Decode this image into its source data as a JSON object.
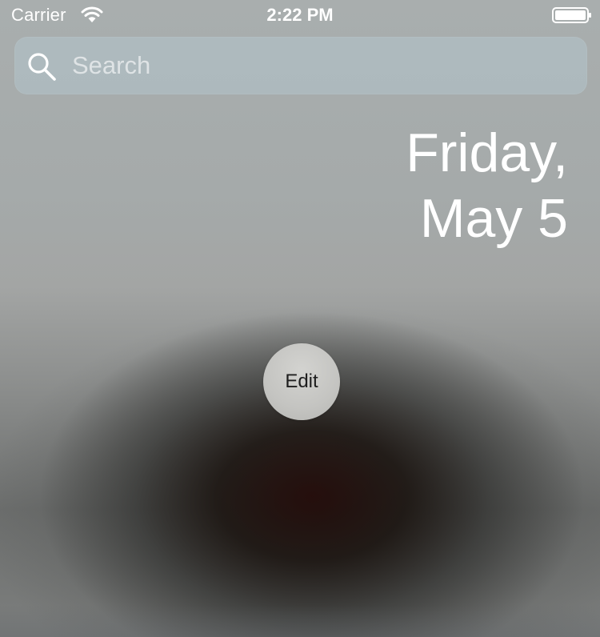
{
  "status_bar": {
    "carrier": "Carrier",
    "time": "2:22 PM",
    "wifi_icon": "wifi-icon",
    "battery_icon": "battery-icon"
  },
  "search": {
    "placeholder": "Search",
    "value": "",
    "icon": "search-icon"
  },
  "date": {
    "weekday": "Friday,",
    "month_day": "May 5"
  },
  "edit": {
    "label": "Edit"
  },
  "colors": {
    "text": "#ffffff",
    "search_bg": "#b2c4cc",
    "edit_button_bg": "#c8c8c5",
    "edit_button_text": "#1e1e1e"
  }
}
